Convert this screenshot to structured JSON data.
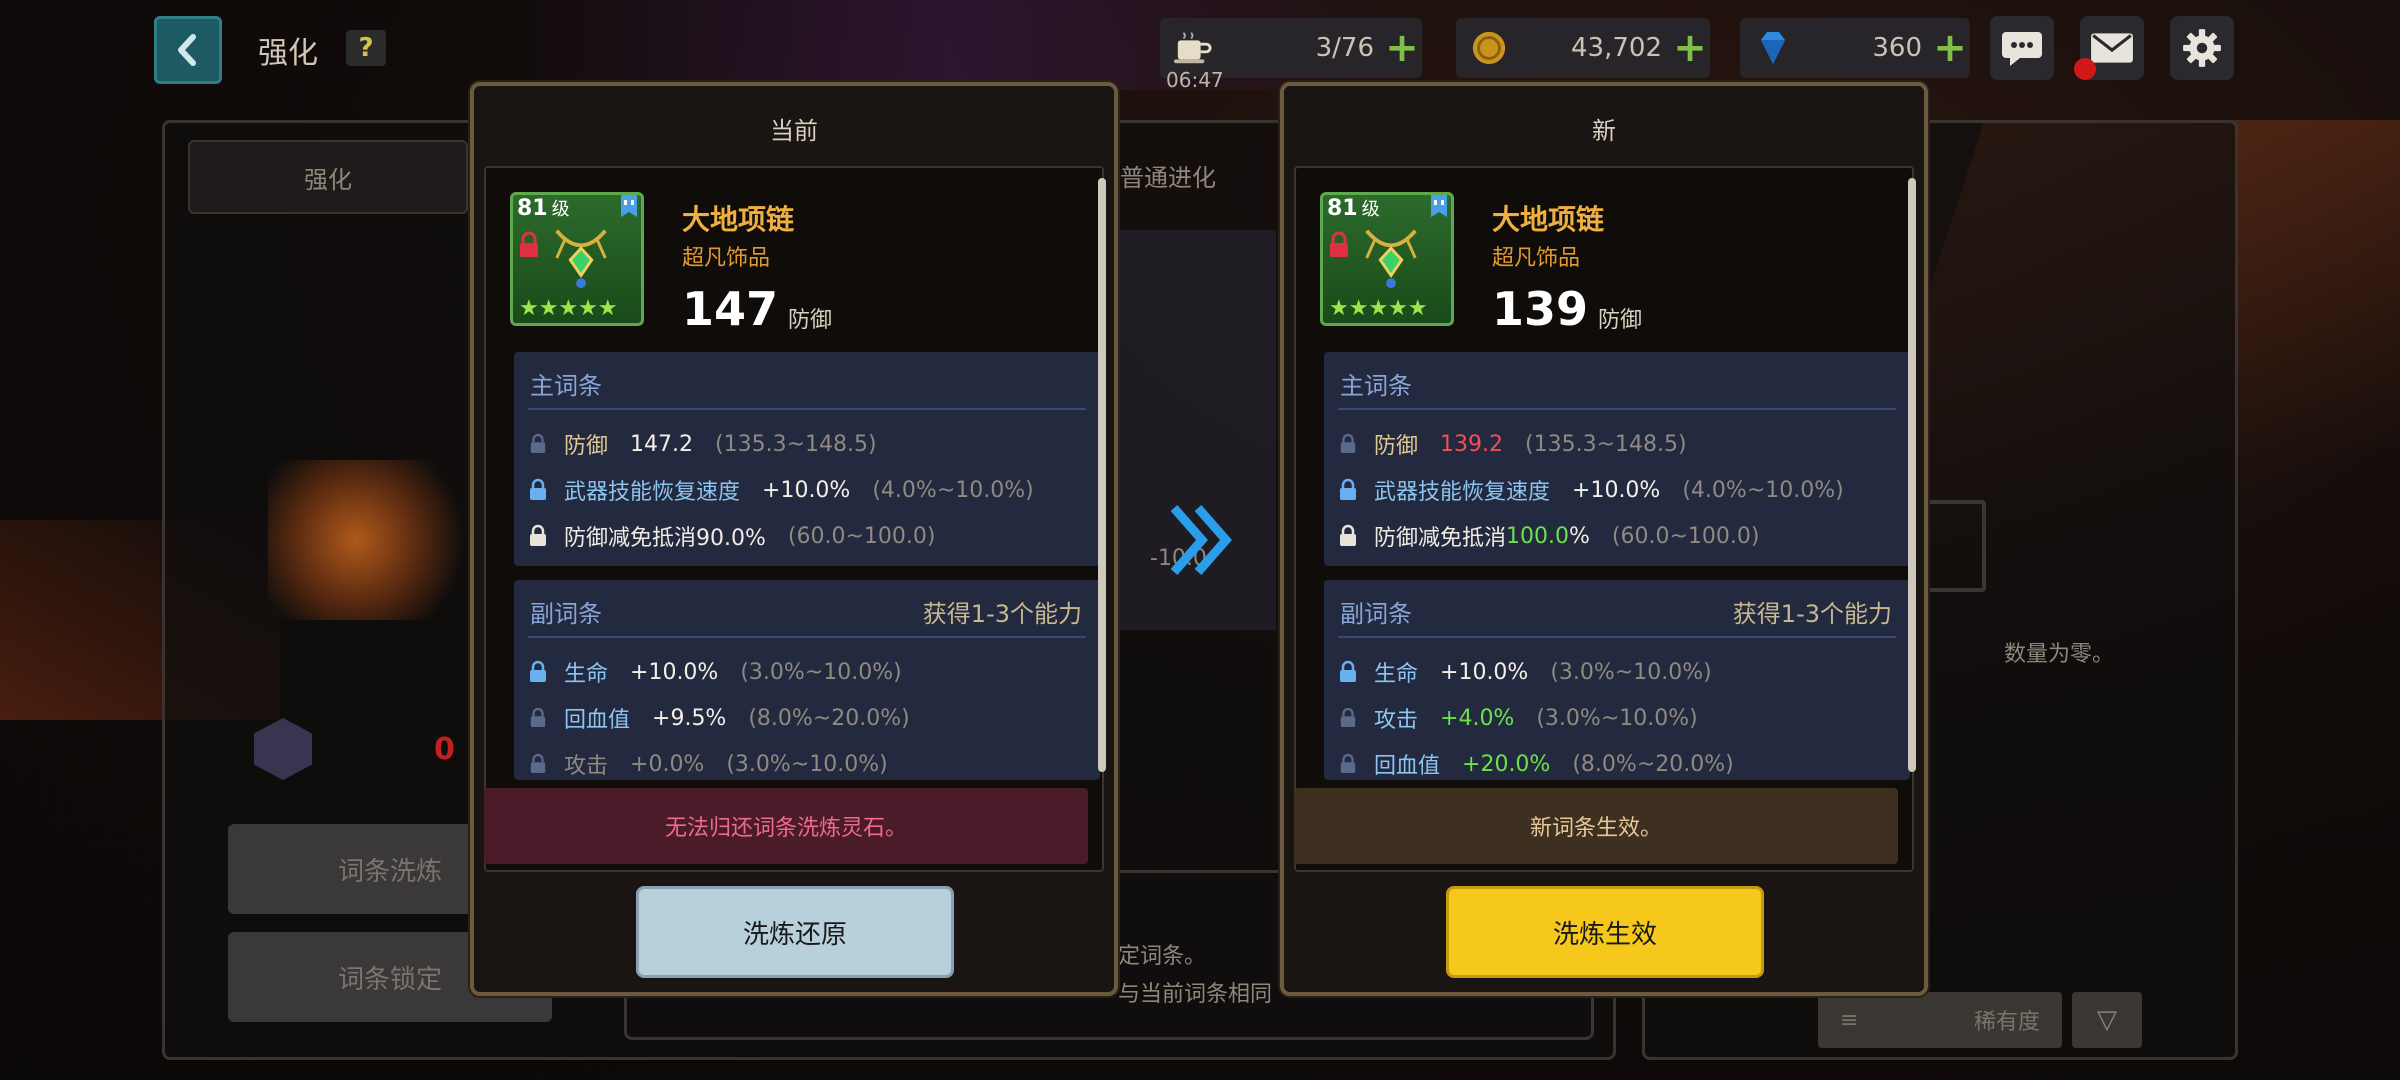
{
  "topbar": {
    "title": "强化",
    "help_label": "?",
    "stamina": {
      "value": "3/76",
      "timer": "06:47"
    },
    "gold": {
      "value": "43,702"
    },
    "gems": {
      "value": "360"
    }
  },
  "background": {
    "tab_enhance": "强化",
    "tab_evolve": "普通进化",
    "reroll_button": "词条洗炼",
    "lock_button": "词条锁定",
    "material_count": "0",
    "empty_text": "数量为零。",
    "sort_label": "稀有度",
    "hint_line1": "定词条。",
    "hint_line2": "与当前词条相同",
    "dim_value": "-10.0"
  },
  "current": {
    "header": "当前",
    "item": {
      "level": "81",
      "level_unit": "级",
      "name": "大地项链",
      "grade": "超凡饰品",
      "power": "147",
      "power_unit": "防御",
      "stars": "★★★★★"
    },
    "main": {
      "title": "主词条",
      "rows": [
        {
          "name": "防御",
          "value": "147.2",
          "range": "(135.3~148.5)"
        },
        {
          "name": "武器技能恢复速度",
          "value": "+10.0%",
          "range": "(4.0%~10.0%)"
        },
        {
          "name": "防御减免抵消90.0%",
          "range": "(60.0~100.0)"
        }
      ]
    },
    "sub": {
      "title": "副词条",
      "right": "获得1-3个能力",
      "rows": [
        {
          "name": "生命",
          "value": "+10.0%",
          "range": "(3.0%~10.0%)"
        },
        {
          "name": "回血值",
          "value": "+9.5%",
          "range": "(8.0%~20.0%)"
        },
        {
          "name": "攻击",
          "value": "+0.0%",
          "range": "(3.0%~10.0%)"
        }
      ]
    },
    "notice": "无法归还词条洗炼灵石。",
    "button": "洗炼还原"
  },
  "new": {
    "header": "新",
    "item": {
      "level": "81",
      "level_unit": "级",
      "name": "大地项链",
      "grade": "超凡饰品",
      "power": "139",
      "power_unit": "防御",
      "stars": "★★★★★"
    },
    "main": {
      "title": "主词条",
      "rows": [
        {
          "name": "防御",
          "value": "139.2",
          "range": "(135.3~148.5)"
        },
        {
          "name": "武器技能恢复速度",
          "value": "+10.0%",
          "range": "(4.0%~10.0%)"
        },
        {
          "name_prefix": "防御减免抵消",
          "name_value": "100.0",
          "name_suffix": "%",
          "range": "(60.0~100.0)"
        }
      ]
    },
    "sub": {
      "title": "副词条",
      "right": "获得1-3个能力",
      "rows": [
        {
          "name": "生命",
          "value": "+10.0%",
          "range": "(3.0%~10.0%)"
        },
        {
          "name": "攻击",
          "value": "+4.0%",
          "range": "(3.0%~10.0%)"
        },
        {
          "name": "回血值",
          "value": "+20.0%",
          "range": "(8.0%~20.0%)"
        }
      ]
    },
    "notice": "新词条生效。",
    "button": "洗炼生效"
  },
  "colors": {
    "value_down": "#f05050",
    "value_up": "#6ee04a",
    "apply_button": "#f6c81c",
    "restore_button": "#b8d0dc"
  },
  "icons": [
    "back-icon",
    "coffee-icon",
    "coin-icon",
    "diamond-icon",
    "chat-icon",
    "mail-icon",
    "gear-icon",
    "lock-icon",
    "bookmark-icon",
    "double-chevron-right-icon"
  ]
}
